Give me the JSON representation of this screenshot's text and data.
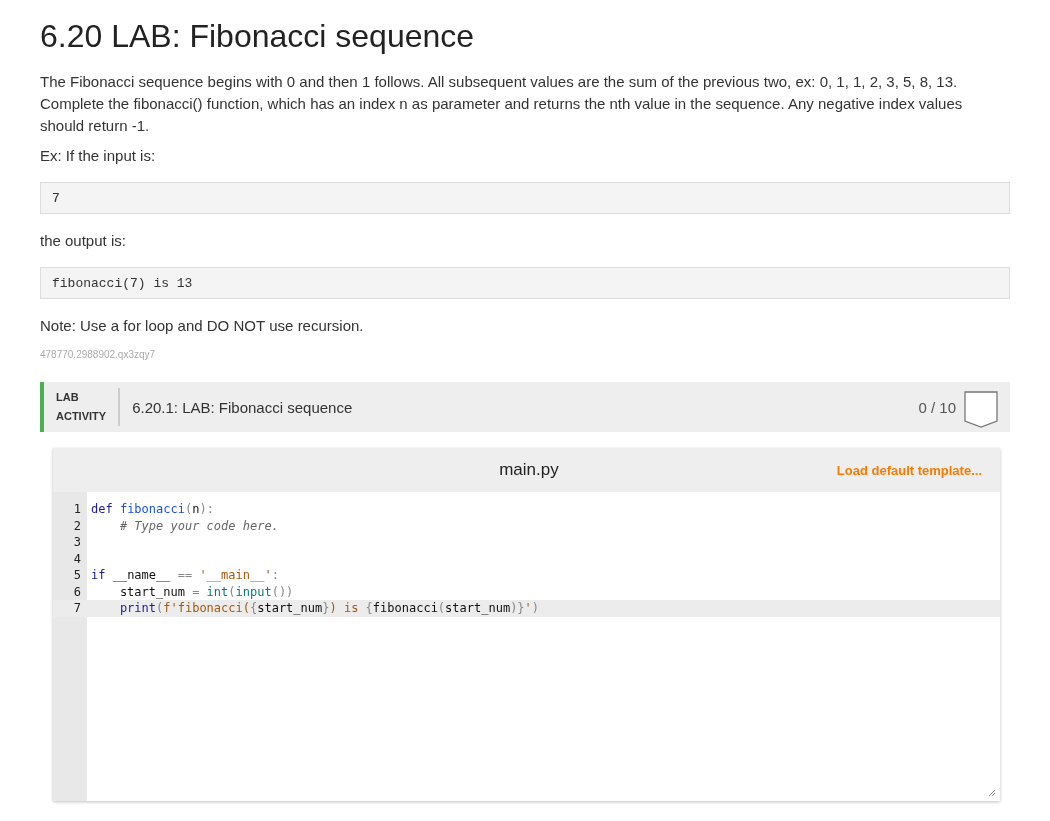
{
  "title": "6.20 LAB: Fibonacci sequence",
  "description": "The Fibonacci sequence begins with 0 and then 1 follows. All subsequent values are the sum of the previous two, ex: 0, 1, 1, 2, 3, 5, 8, 13. Complete the fibonacci() function, which has an index n as parameter and returns the nth value in the sequence. Any negative index values should return -1.",
  "example_intro": "Ex: If the input is:",
  "example_input": "7",
  "output_intro": "the output is:",
  "example_output": "fibonacci(7) is 13",
  "note": "Note: Use a for loop and **DO NOT** use recursion.",
  "lab_id": "478770.2988902.qx3zqy7",
  "lab": {
    "label_line_1": "LAB",
    "label_line_2": "ACTIVITY",
    "title": "6.20.1: LAB: Fibonacci sequence",
    "score": "0 / 10"
  },
  "editor": {
    "filename": "main.py",
    "template_link": "Load default template...",
    "lines": [
      {
        "number": "1",
        "active": false,
        "tokens": [
          {
            "kind": "kw",
            "text": "def"
          },
          {
            "kind": "def",
            "text": " fibonacci"
          },
          {
            "kind": "op",
            "text": "("
          },
          {
            "kind": "plain",
            "text": "n"
          },
          {
            "kind": "op",
            "text": "):"
          }
        ]
      },
      {
        "number": "2",
        "active": false,
        "tokens": [
          {
            "kind": "comment",
            "text": "    # Type your code here."
          }
        ]
      },
      {
        "number": "3",
        "active": false
      },
      {
        "number": "4",
        "active": false
      },
      {
        "number": "5",
        "active": false,
        "tokens": [
          {
            "kind": "kw",
            "text": "if"
          },
          {
            "kind": "plain",
            "text": " __name__ "
          },
          {
            "kind": "op",
            "text": "=="
          },
          {
            "kind": "string",
            "text": " '__main__'"
          },
          {
            "kind": "op",
            "text": ":"
          }
        ]
      },
      {
        "number": "6",
        "active": false,
        "tokens": [
          {
            "kind": "plain",
            "text": "    start_num "
          },
          {
            "kind": "op",
            "text": "="
          },
          {
            "kind": "builtin",
            "text": " int"
          },
          {
            "kind": "op",
            "text": "("
          },
          {
            "kind": "builtin",
            "text": "input"
          },
          {
            "kind": "op",
            "text": "())"
          }
        ]
      },
      {
        "number": "7",
        "active": true,
        "tokens": [
          {
            "kind": "kw",
            "text": "    print"
          },
          {
            "kind": "op",
            "text": "("
          },
          {
            "kind": "string",
            "text": "f'fibonacci("
          },
          {
            "kind": "op",
            "text": "{"
          },
          {
            "kind": "plain",
            "text": "start_num"
          },
          {
            "kind": "op",
            "text": "}"
          },
          {
            "kind": "string",
            "text": ") is "
          },
          {
            "kind": "op",
            "text": "{"
          },
          {
            "kind": "plain",
            "text": "fibonacci"
          },
          {
            "kind": "op",
            "text": "("
          },
          {
            "kind": "plain",
            "text": "start_num"
          },
          {
            "kind": "op",
            "text": ")}"
          },
          {
            "kind": "string",
            "text": "'"
          },
          {
            "kind": "op",
            "text": ")"
          }
        ]
      }
    ]
  }
}
